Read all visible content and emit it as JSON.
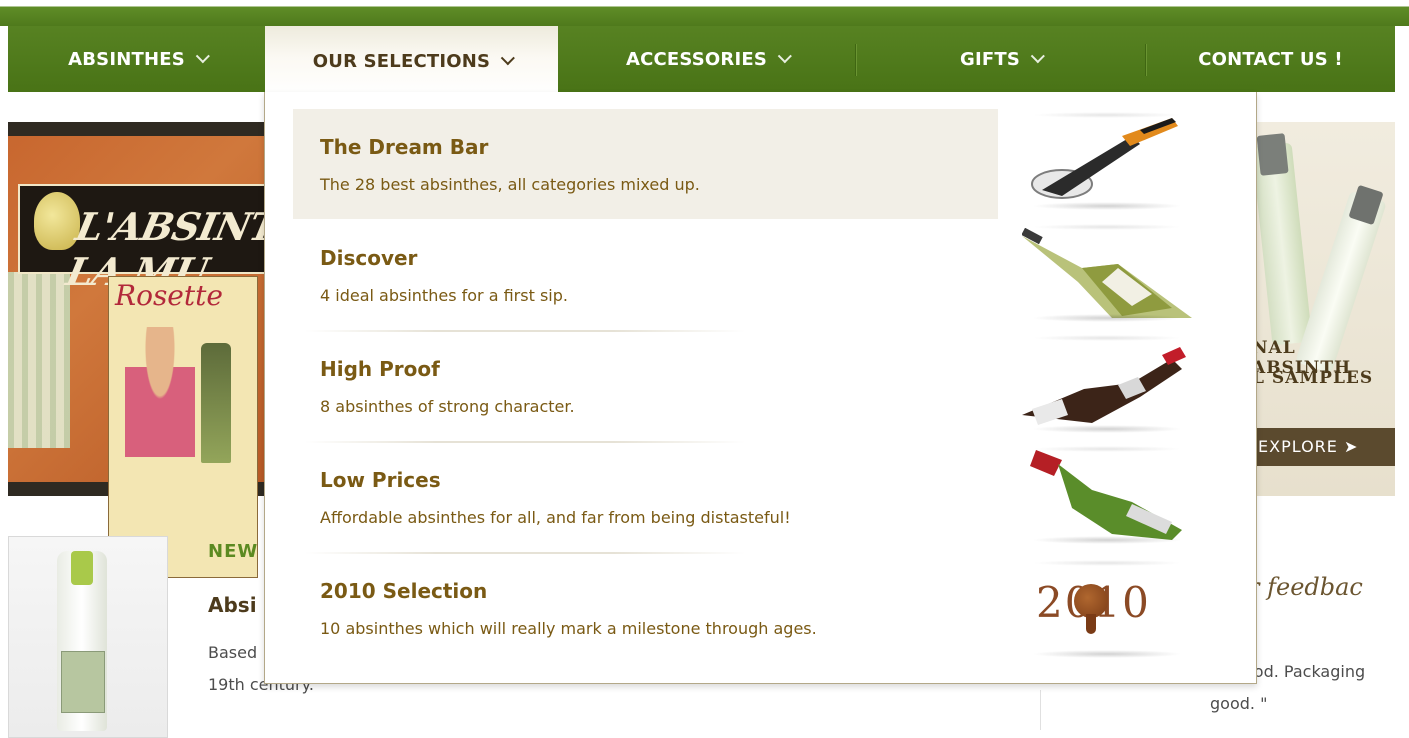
{
  "nav": {
    "items": [
      {
        "label": "ABSINTHES",
        "has_dropdown": true
      },
      {
        "label": "OUR SELECTIONS",
        "has_dropdown": true,
        "active": true
      },
      {
        "label": "ACCESSORIES",
        "has_dropdown": true
      },
      {
        "label": "GIFTS",
        "has_dropdown": true
      },
      {
        "label": "CONTACT US !",
        "has_dropdown": false
      }
    ]
  },
  "dropdown": {
    "items": [
      {
        "title": "The Dream Bar",
        "desc": "The 28 best absinthes, all categories mixed up.",
        "thumb": "absinthe-spoon-image",
        "highlighted": true
      },
      {
        "title": "Discover",
        "desc": "4 ideal absinthes for a first sip.",
        "thumb": "green-bottle-image"
      },
      {
        "title": "High Proof",
        "desc": "8 absinthes of strong character.",
        "thumb": "dark-bottle-image"
      },
      {
        "title": "Low Prices",
        "desc": "Affordable absinthes for all, and far from being distasteful!",
        "thumb": "red-cap-bottle-image"
      },
      {
        "title": "2010 Selection",
        "desc": "10 absinthes which will really mark a milestone through ages.",
        "thumb": "wax-seal-2010-image"
      }
    ],
    "seal_year": "2010"
  },
  "banner_left": {
    "poster_text": "L'ABSINTHE LA MU",
    "rosette_text": "Rosette"
  },
  "banner_right": {
    "line1": "NAL ABSINTH",
    "line2": "L SAMPLES",
    "explore_label": "EXPLORE ➤"
  },
  "product": {
    "new_label": "NEW",
    "title": "Absi",
    "desc_line1": "Based",
    "desc_line2": "19th century."
  },
  "feedback": {
    "heading": "r feedbac",
    "quote_line1": "ood. Packaging",
    "quote_line2": "good. \""
  },
  "colors": {
    "nav_green": "#4f7a1c",
    "menu_text": "#7a5a14",
    "highlight_bg": "#f2efe7",
    "accent_green": "#5b8a21"
  }
}
